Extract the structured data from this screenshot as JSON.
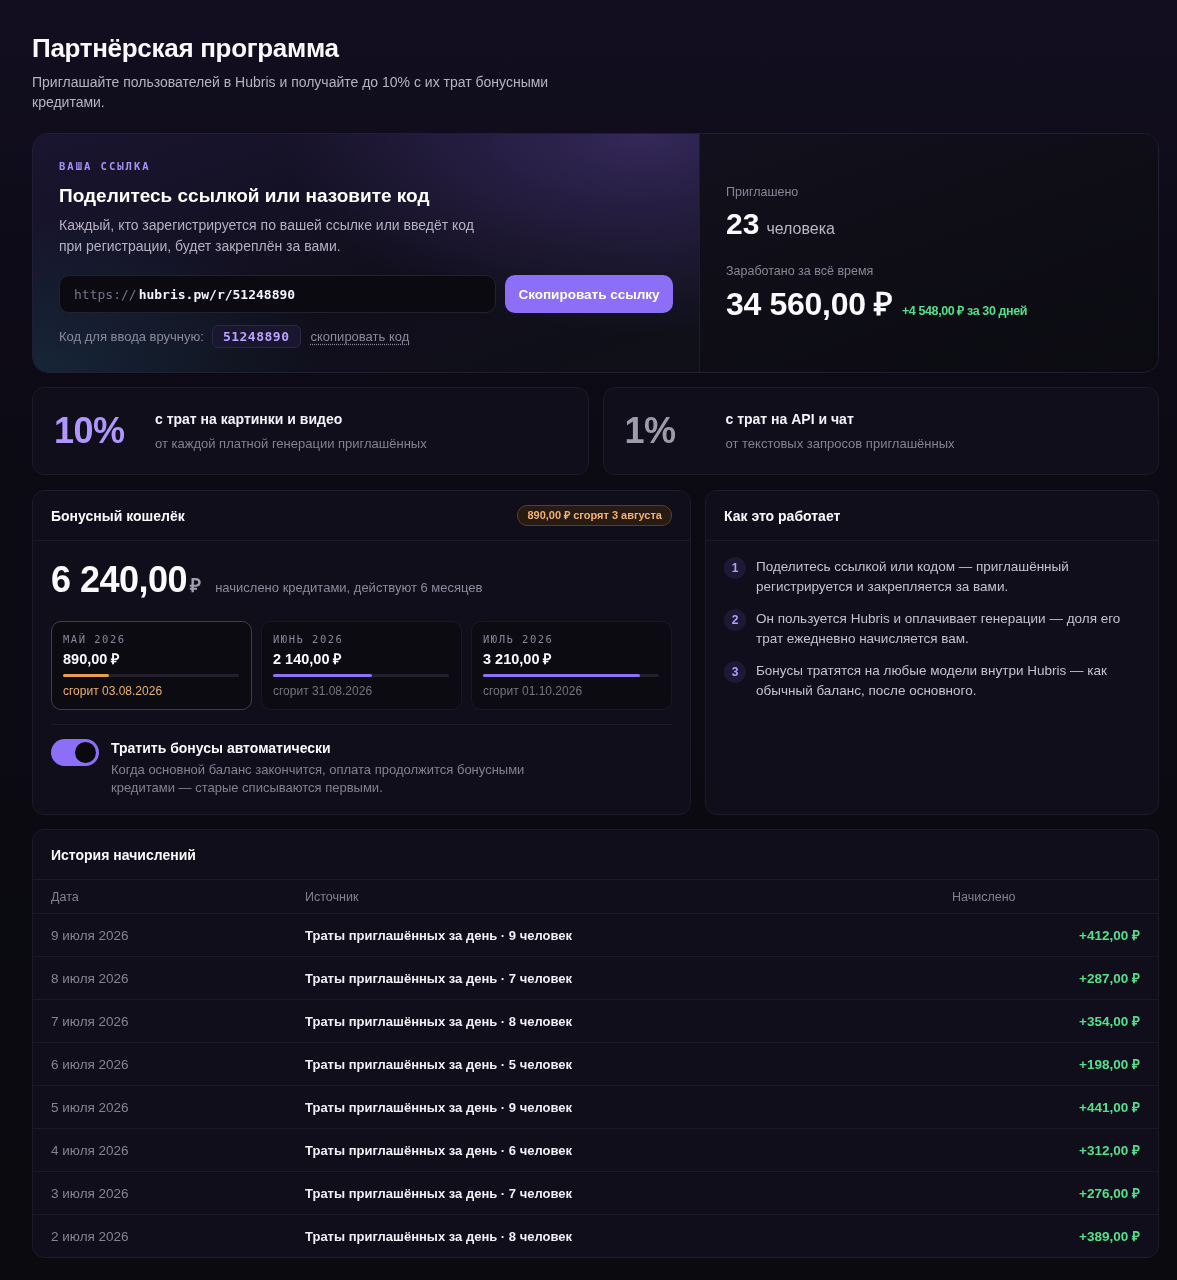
{
  "header": {
    "title": "Партнёрская программа",
    "subtitle": "Приглашайте пользователей в Hubris и получайте до 10% с их трат бонусными кредитами."
  },
  "referral": {
    "eyebrow": "ВАША ССЫЛКА",
    "title": "Поделитесь ссылкой или назовите код",
    "description": "Каждый, кто зарегистрируется по вашей ссылке или введёт код при регистрации, будет закреплён за вами.",
    "link": {
      "prefix": "https://",
      "value": "hubris.pw/r/51248890"
    },
    "copy_button": "Скопировать ссылку",
    "code_label": "Код для ввода вручную:",
    "code": "51248890",
    "copy_code_link": "скопировать код"
  },
  "stats": {
    "invited": {
      "label": "Приглашено",
      "value": "23",
      "unit": "человека"
    },
    "earned": {
      "label": "Заработано за всё время",
      "value": "34 560,00 ₽",
      "delta": "+4 548,00 ₽ за 30 дней"
    }
  },
  "rates": [
    {
      "percent": "10%",
      "title": "с трат на картинки и видео",
      "description": "от каждой платной генерации приглашённых",
      "highlighted": true
    },
    {
      "percent": "1%",
      "title": "с трат на API и чат",
      "description": "от текстовых запросов приглашённых",
      "highlighted": false
    }
  ],
  "wallet": {
    "title": "Бонусный кошелёк",
    "expiry_badge": "890,00 ₽ сгорят 3 августа",
    "balance": "6 240,00",
    "currency": "₽",
    "balance_note": "начислено кредитами, действуют 6 месяцев",
    "batches": [
      {
        "month": "МАЙ 2026",
        "amount": "890,00 ₽",
        "level": 0.26,
        "expires": "сгорит 03.08.2026",
        "expiring_soon": true
      },
      {
        "month": "ИЮНЬ 2026",
        "amount": "2 140,00 ₽",
        "level": 0.56,
        "expires": "сгорит 31.08.2026",
        "expiring_soon": false
      },
      {
        "month": "ИЮЛЬ 2026",
        "amount": "3 210,00 ₽",
        "level": 0.89,
        "expires": "сгорит 01.10.2026",
        "expiring_soon": false
      }
    ],
    "auto_spend": {
      "label": "Тратить бонусы автоматически",
      "description": "Когда основной баланс закончится, оплата продолжится бонусными кредитами — старые списываются первыми.",
      "on": true
    }
  },
  "how_it_works": {
    "title": "Как это работает",
    "steps": [
      {
        "number": "1",
        "text": "Поделитесь ссылкой или кодом — приглашённый регистрируется и закрепляется за вами."
      },
      {
        "number": "2",
        "text": "Он пользуется Hubris и оплачивает генерации — доля его трат ежедневно начисляется вам."
      },
      {
        "number": "3",
        "text": "Бонусы тратятся на любые модели внутри Hubris — как обычный баланс, после основного."
      }
    ]
  },
  "history": {
    "title": "История начислений",
    "columns": [
      "Дата",
      "Источник",
      "Начислено"
    ],
    "rows": [
      {
        "date": "9 июля 2026",
        "source": "Траты приглашённых за день · 9 человек",
        "amount": "+412,00 ₽"
      },
      {
        "date": "8 июля 2026",
        "source": "Траты приглашённых за день · 7 человек",
        "amount": "+287,00 ₽"
      },
      {
        "date": "7 июля 2026",
        "source": "Траты приглашённых за день · 8 человек",
        "amount": "+354,00 ₽"
      },
      {
        "date": "6 июля 2026",
        "source": "Траты приглашённых за день · 5 человек",
        "amount": "+198,00 ₽"
      },
      {
        "date": "5 июля 2026",
        "source": "Траты приглашённых за день · 9 человек",
        "amount": "+441,00 ₽"
      },
      {
        "date": "4 июля 2026",
        "source": "Траты приглашённых за день · 6 человек",
        "amount": "+312,00 ₽"
      },
      {
        "date": "3 июля 2026",
        "source": "Траты приглашённых за день · 7 человек",
        "amount": "+276,00 ₽"
      },
      {
        "date": "2 июля 2026",
        "source": "Траты приглашённых за день · 8 человек",
        "amount": "+389,00 ₽"
      }
    ]
  }
}
